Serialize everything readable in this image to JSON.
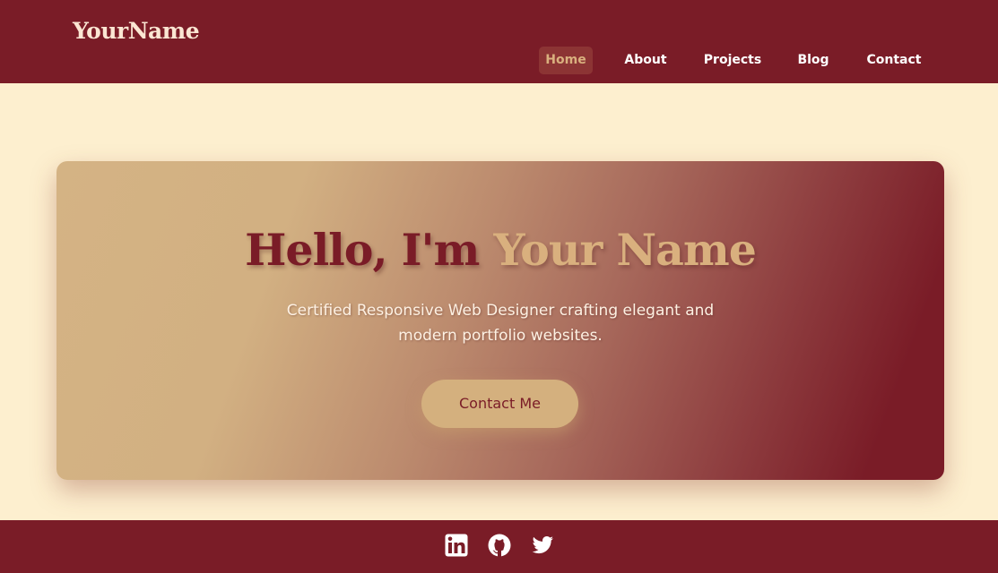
{
  "header": {
    "brand": "YourName",
    "nav": [
      {
        "label": "Home",
        "active": true
      },
      {
        "label": "About",
        "active": false
      },
      {
        "label": "Projects",
        "active": false
      },
      {
        "label": "Blog",
        "active": false
      },
      {
        "label": "Contact",
        "active": false
      }
    ]
  },
  "hero": {
    "greeting": "Hello, I'm",
    "name": "Your Name",
    "subtitle": "Certified Responsive Web Designer crafting elegant and modern portfolio websites.",
    "cta_label": "Contact Me"
  },
  "footer": {
    "social": [
      {
        "icon": "linkedin-icon"
      },
      {
        "icon": "github-icon"
      },
      {
        "icon": "twitter-icon"
      }
    ]
  },
  "colors": {
    "primary": "#7a1c27",
    "accent": "#d4b07e",
    "background": "#fdefcf"
  }
}
